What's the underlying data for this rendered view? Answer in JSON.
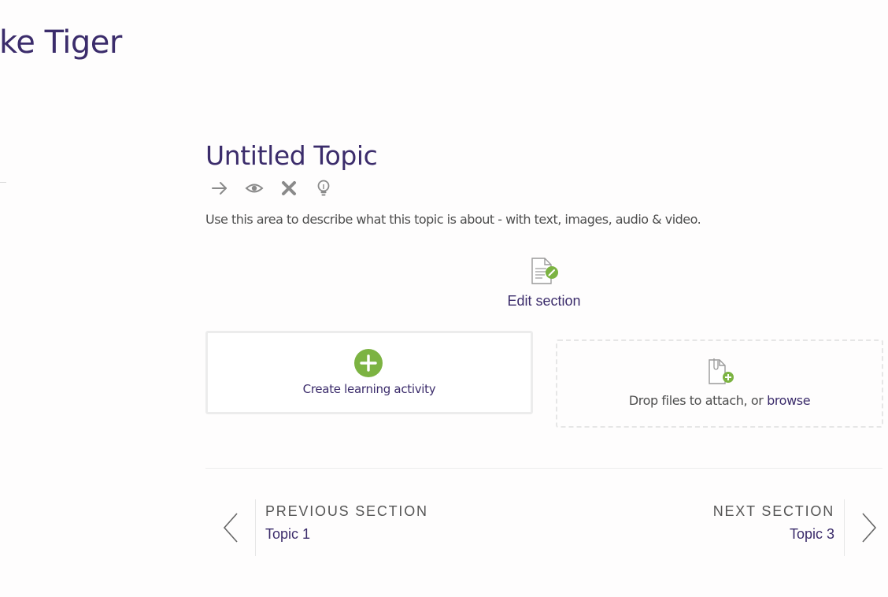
{
  "course": {
    "title": "ke Tiger"
  },
  "section": {
    "title": "Untitled Topic",
    "toolbar": [
      {
        "name": "move-arrow-icon"
      },
      {
        "name": "eye-icon"
      },
      {
        "name": "delete-x-icon"
      },
      {
        "name": "lightbulb-icon"
      }
    ],
    "summary": "Use this area to describe what this topic is about - with text, images, audio & video.",
    "edit_label": "Edit section"
  },
  "create_activity": {
    "label": "Create learning activity"
  },
  "drop_zone": {
    "text": "Drop files to attach, or ",
    "browse": "browse"
  },
  "navigation": {
    "previous": {
      "kicker": "PREVIOUS SECTION",
      "name": "Topic 1"
    },
    "next": {
      "kicker": "NEXT SECTION",
      "name": "Topic 3"
    }
  },
  "colors": {
    "brand_purple": "#3b2c6b",
    "accent_green": "#7cb342",
    "icon_grey": "#888888"
  }
}
